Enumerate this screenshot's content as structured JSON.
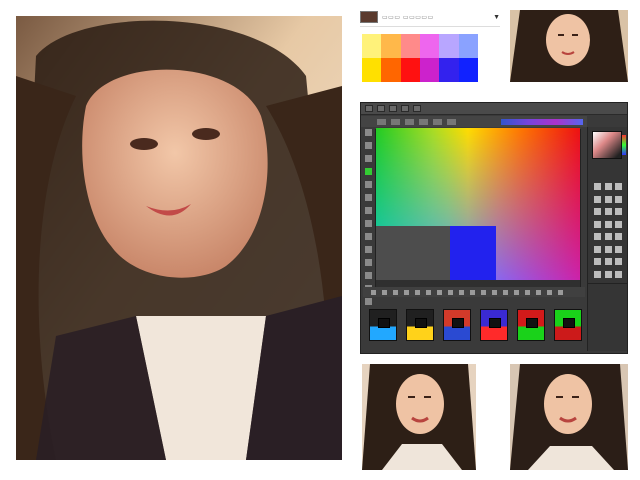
{
  "swatch_header": {
    "chip_color": "#5a3a2e",
    "label": "▭▭▭ ▭▭▭▭▭"
  },
  "swatch_colors": [
    "#fff27a",
    "#ffb84a",
    "#ff8a8a",
    "#ee66ee",
    "#b8a6ff",
    "#8aa2ff",
    "#ffe000",
    "#ff6600",
    "#ff1111",
    "#cc22cc",
    "#3322ee",
    "#1122ff"
  ],
  "editor": {
    "accent_color": "#5566ee",
    "thumb_variants": [
      {
        "top": "#202020",
        "bottom": "#22a8ff"
      },
      {
        "top": "#202020",
        "bottom": "#ffd21a"
      },
      {
        "top": "#d23a2a",
        "bottom": "#2a4ad2"
      },
      {
        "top": "#3a2ad2",
        "bottom": "#ff2a2a"
      },
      {
        "top": "#d21a1a",
        "bottom": "#1ad21a"
      },
      {
        "top": "#1ad21a",
        "bottom": "#cc1a1a"
      }
    ]
  },
  "images": [
    {
      "name": "main-portrait"
    },
    {
      "name": "thumb-top"
    },
    {
      "name": "thumb-bottom-left"
    },
    {
      "name": "thumb-bottom-right"
    }
  ]
}
